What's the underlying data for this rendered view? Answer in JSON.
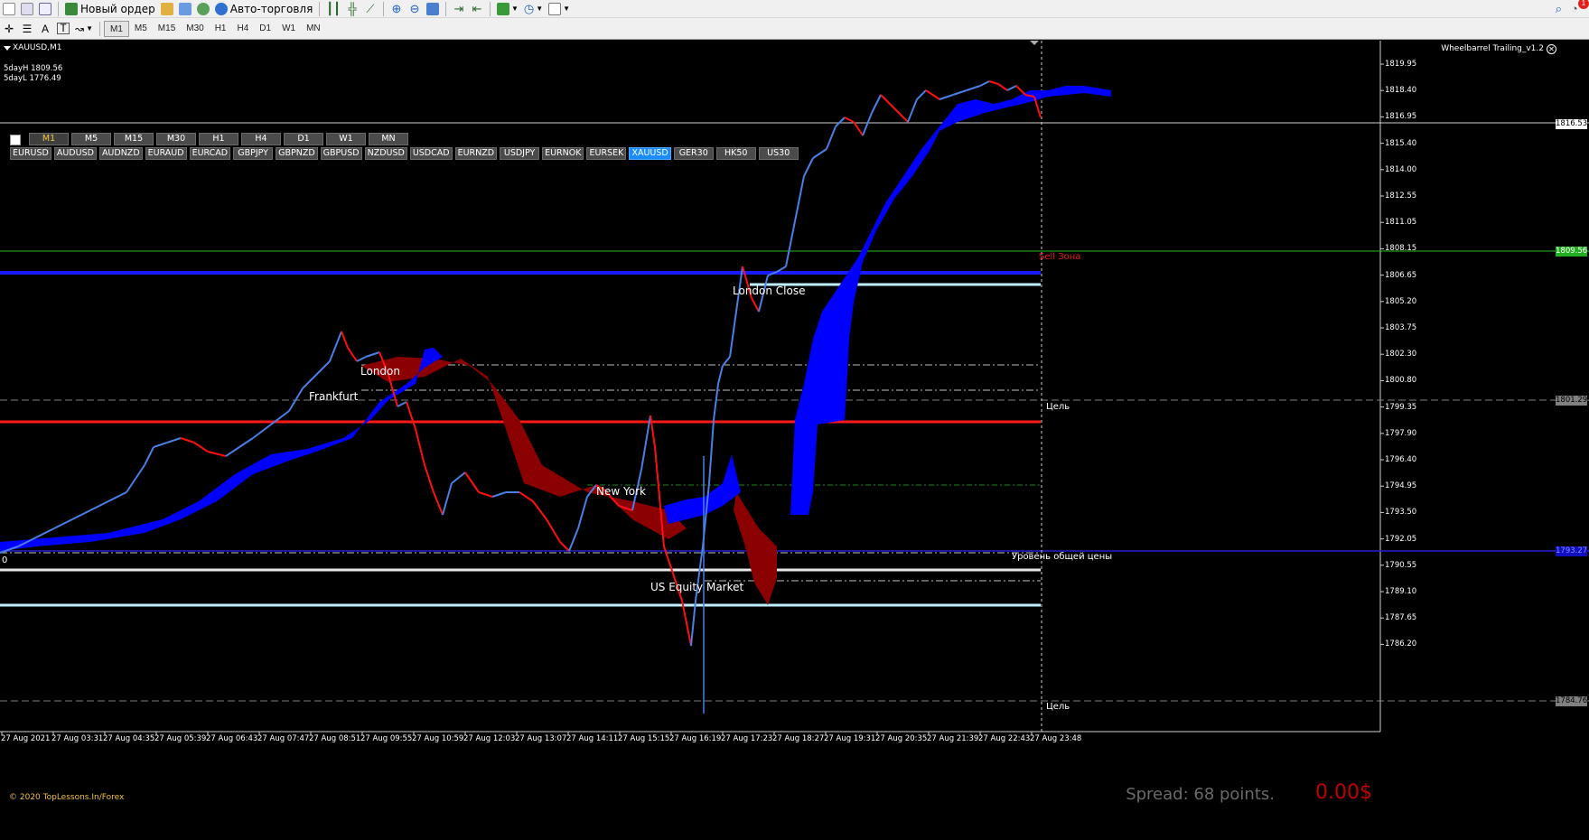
{
  "toolbar": {
    "new_order_label": "Новый ордер",
    "auto_trading_label": "Авто-торговля",
    "timeframes": [
      "M1",
      "M5",
      "M15",
      "M30",
      "H1",
      "H4",
      "D1",
      "W1",
      "MN"
    ],
    "active_timeframe": "M1",
    "notification_count": "1"
  },
  "chart": {
    "symbol_title": "XAUUSD,M1",
    "five_day_high": "5dayH 1809.56",
    "five_day_low": "5dayL 1776.49",
    "ea_name": "Wheelbarrel Trailing_v1.2",
    "panel_timeframes": [
      "M1",
      "M5",
      "M15",
      "M30",
      "H1",
      "H4",
      "D1",
      "W1",
      "MN"
    ],
    "panel_active_timeframe": "M1",
    "panel_symbols": [
      "EURUSD",
      "AUDUSD",
      "AUDNZD",
      "EURAUD",
      "EURCAD",
      "GBPJPY",
      "GBPNZD",
      "GBPUSD",
      "NZDUSD",
      "USDCAD",
      "EURNZD",
      "USDJPY",
      "EURNOK",
      "EURSEK",
      "XAUUSD",
      "GER30",
      "HK50",
      "US30"
    ],
    "panel_active_symbol": "XAUUSD",
    "sessions": {
      "london": "London",
      "frankfurt": "Frankfurt",
      "new_york": "New York",
      "us_equity": "US Equity Market",
      "london_close": "London Close"
    },
    "zone_labels": {
      "sell_zone": "Sell Зона",
      "target_top": "Цель",
      "target_bottom": "Цель",
      "common_price_level": "Уровень общей цены",
      "left_marker": "0"
    },
    "price_axis": {
      "ticks": [
        "1819.95",
        "1818.40",
        "1816.95",
        "1815.40",
        "1814.00",
        "1812.55",
        "1811.05",
        "1808.15",
        "1806.65",
        "1805.20",
        "1803.75",
        "1802.30",
        "1800.80",
        "1799.35",
        "1797.90",
        "1796.40",
        "1794.95",
        "1793.50",
        "1792.05",
        "1790.55",
        "1789.10",
        "1787.65",
        "1786.20"
      ],
      "current_price_tag": "1816.53",
      "green_line_tag": "1809.56",
      "dashed_tag_upper": "1801.29",
      "dashed_tag_lower": "1784.76",
      "blue_line_tag": "1793.27"
    },
    "time_axis": [
      "27 Aug 2021",
      "27 Aug 03:31",
      "27 Aug 04:35",
      "27 Aug 05:39",
      "27 Aug 06:43",
      "27 Aug 07:47",
      "27 Aug 08:51",
      "27 Aug 09:55",
      "27 Aug 10:59",
      "27 Aug 12:03",
      "27 Aug 13:07",
      "27 Aug 14:11",
      "27 Aug 15:15",
      "27 Aug 16:19",
      "27 Aug 17:23",
      "27 Aug 18:27",
      "27 Aug 19:31",
      "27 Aug 20:35",
      "27 Aug 21:39",
      "27 Aug 22:43",
      "27 Aug 23:48"
    ],
    "copyright": "© 2020 TopLessons.In/Forex",
    "spread": "Spread: 68 points.",
    "profit": "0.00$"
  },
  "colors": {
    "up_candle": "#4a7fe6",
    "down_candle": "#ff1010",
    "cloud_bull": "#0000ff",
    "cloud_bear": "#8b0000",
    "active_symbol": "#1a8cff"
  }
}
